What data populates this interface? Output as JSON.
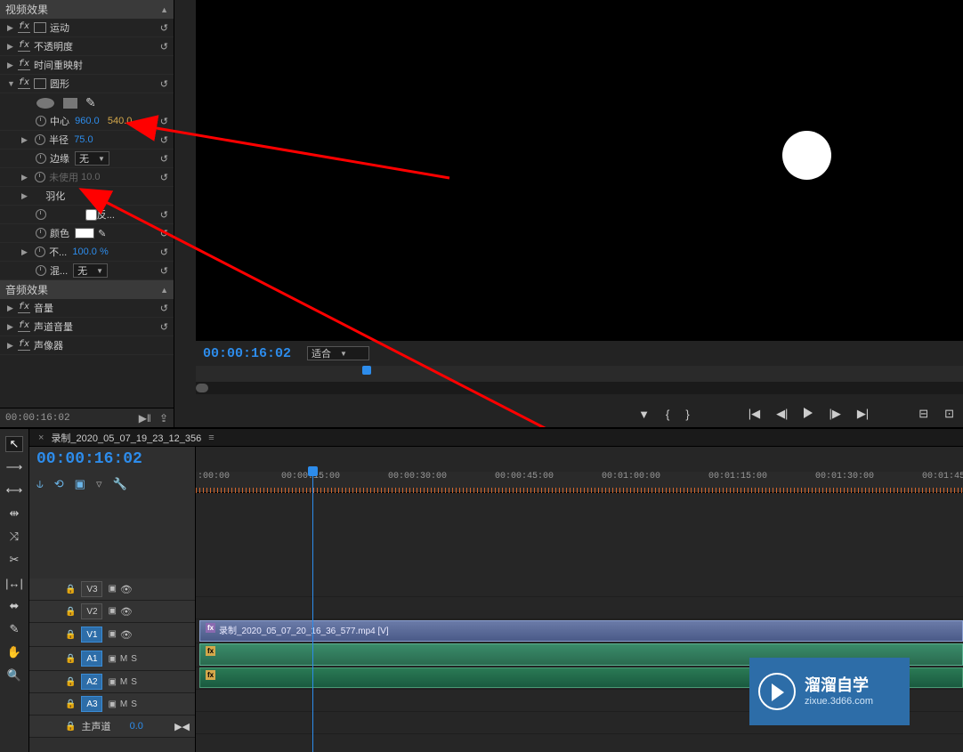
{
  "effects": {
    "video_header": "视频效果",
    "motion": "运动",
    "opacity": "不透明度",
    "time_remap": "时间重映射",
    "circle": {
      "name": "圆形",
      "center_label": "中心",
      "center_x": "960.0",
      "center_y": "540.0",
      "radius_label": "半径",
      "radius_val": "75.0",
      "edge_label": "边缘",
      "edge_val": "无",
      "unused_label": "未使用",
      "unused_val": "10.0",
      "feather_label": "羽化",
      "invert_label": "反...",
      "color_label": "颜色",
      "opacity_label": "不...",
      "opacity_val": "100.0 %",
      "blend_label": "混...",
      "blend_val": "无"
    },
    "audio_header": "音频效果",
    "volume": "音量",
    "channel_volume": "声道音量",
    "panner": "声像器"
  },
  "panel_tc": "00:00:16:02",
  "monitor": {
    "tc": "00:00:16:02",
    "fit": "适合"
  },
  "sequence": {
    "name": "录制_2020_05_07_19_23_12_356",
    "tc": "00:00:16:02"
  },
  "ruler": {
    "t0": ":00:00",
    "t1": "00:00:15:00",
    "t2": "00:00:30:00",
    "t3": "00:00:45:00",
    "t4": "00:01:00:00",
    "t5": "00:01:15:00",
    "t6": "00:01:30:00",
    "t7": "00:01:45"
  },
  "tracks": {
    "v3": "V3",
    "v2": "V2",
    "v1": "V1",
    "a1": "A1",
    "a2": "A2",
    "a3": "A3",
    "master": "主声道",
    "master_val": "0.0",
    "m": "M",
    "s": "S"
  },
  "clip": {
    "video_name": "录制_2020_05_07_20_16_36_577.mp4 [V]"
  },
  "watermark": {
    "title": "溜溜自学",
    "sub": "zixue.3d66.com"
  }
}
